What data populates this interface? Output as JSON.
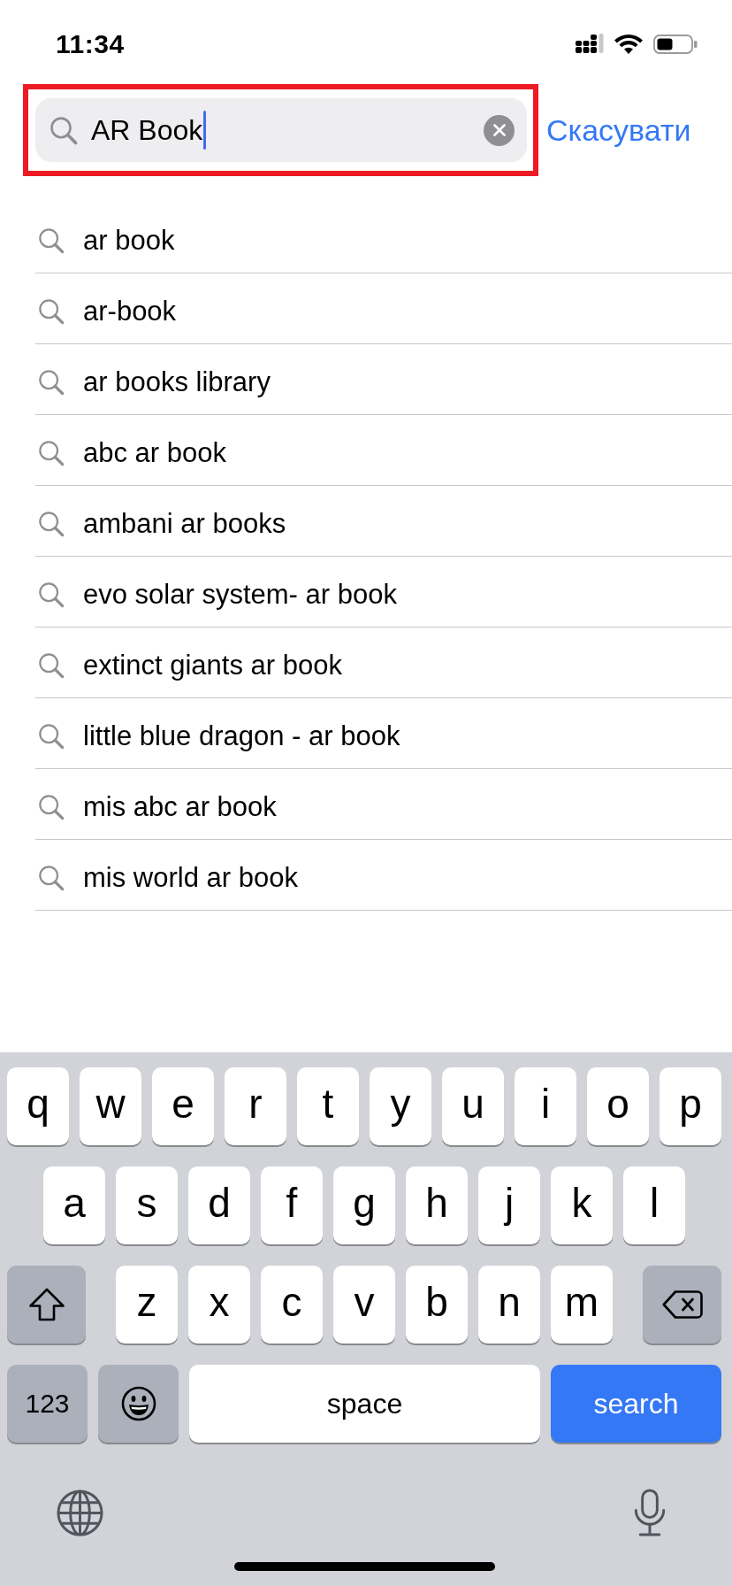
{
  "status_bar": {
    "time": "11:34"
  },
  "search": {
    "value": "AR Book",
    "focused": true,
    "highlighted": true,
    "cancel": "Скасувати"
  },
  "suggestions": [
    "ar book",
    "ar-book",
    "ar books library",
    "abc ar book",
    "ambani ar books",
    "evo solar system- ar book",
    "extinct giants ar book",
    "little blue dragon - ar book",
    "mis abc ar book",
    "mis world ar book"
  ],
  "keyboard": {
    "rows": [
      {
        "keys": [
          {
            "kind": "letter",
            "label": "q"
          },
          {
            "kind": "letter",
            "label": "w"
          },
          {
            "kind": "letter",
            "label": "e"
          },
          {
            "kind": "letter",
            "label": "r"
          },
          {
            "kind": "letter",
            "label": "t"
          },
          {
            "kind": "letter",
            "label": "y"
          },
          {
            "kind": "letter",
            "label": "u"
          },
          {
            "kind": "letter",
            "label": "i"
          },
          {
            "kind": "letter",
            "label": "o"
          },
          {
            "kind": "letter",
            "label": "p"
          }
        ]
      },
      {
        "keys": [
          {
            "kind": "letter",
            "label": "a"
          },
          {
            "kind": "letter",
            "label": "s"
          },
          {
            "kind": "letter",
            "label": "d"
          },
          {
            "kind": "letter",
            "label": "f"
          },
          {
            "kind": "letter",
            "label": "g"
          },
          {
            "kind": "letter",
            "label": "h"
          },
          {
            "kind": "letter",
            "label": "j"
          },
          {
            "kind": "letter",
            "label": "k"
          },
          {
            "kind": "letter",
            "label": "l"
          }
        ]
      },
      {
        "keys": [
          {
            "kind": "shift"
          },
          {
            "kind": "letter",
            "label": "z"
          },
          {
            "kind": "letter",
            "label": "x"
          },
          {
            "kind": "letter",
            "label": "c"
          },
          {
            "kind": "letter",
            "label": "v"
          },
          {
            "kind": "letter",
            "label": "b"
          },
          {
            "kind": "letter",
            "label": "n"
          },
          {
            "kind": "letter",
            "label": "m"
          },
          {
            "kind": "backspace"
          }
        ]
      },
      {
        "keys": [
          {
            "kind": "numbers",
            "label": "123"
          },
          {
            "kind": "emoji"
          },
          {
            "kind": "space",
            "label": "space"
          },
          {
            "kind": "search",
            "label": "search"
          }
        ]
      }
    ]
  }
}
